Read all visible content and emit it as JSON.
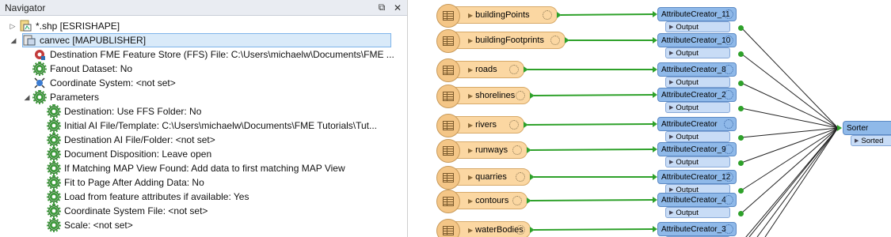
{
  "navigator": {
    "title": "Navigator",
    "tree": [
      {
        "level": 0,
        "twisty": "▷",
        "icon": "shapefile-icon",
        "label": "*.shp [ESRISHAPE]"
      },
      {
        "level": 0,
        "twisty": "◢",
        "icon": "dataset-icon",
        "label": "canvec [MAPUBLISHER]",
        "selected": true
      },
      {
        "level": 1,
        "twisty": "",
        "icon": "ffs-store-icon",
        "label": "Destination FME Feature Store (FFS) File: C:\\Users\\michaelw\\Documents\\FME ..."
      },
      {
        "level": 1,
        "twisty": "",
        "icon": "gear-icon",
        "label": "Fanout Dataset: No"
      },
      {
        "level": 1,
        "twisty": "",
        "icon": "coordinate-system-icon",
        "label": "Coordinate System: <not set>"
      },
      {
        "level": 1,
        "twisty": "◢",
        "icon": "gear-icon",
        "label": "Parameters"
      },
      {
        "level": 2,
        "twisty": "",
        "icon": "gear-icon",
        "label": "Destination: Use FFS Folder: No"
      },
      {
        "level": 2,
        "twisty": "",
        "icon": "gear-icon",
        "label": "Initial AI File/Template: C:\\Users\\michaelw\\Documents\\FME Tutorials\\Tut..."
      },
      {
        "level": 2,
        "twisty": "",
        "icon": "gear-icon",
        "label": "Destination AI File/Folder: <not set>"
      },
      {
        "level": 2,
        "twisty": "",
        "icon": "gear-icon",
        "label": "Document Disposition: Leave open"
      },
      {
        "level": 2,
        "twisty": "",
        "icon": "gear-icon",
        "label": "If Matching MAP View Found: Add data to first matching MAP View"
      },
      {
        "level": 2,
        "twisty": "",
        "icon": "gear-icon",
        "label": "Fit to Page After Adding Data: No"
      },
      {
        "level": 2,
        "twisty": "",
        "icon": "gear-icon",
        "label": "Load from feature attributes if available: Yes"
      },
      {
        "level": 2,
        "twisty": "",
        "icon": "gear-icon",
        "label": "Coordinate System File: <not set>"
      },
      {
        "level": 2,
        "twisty": "",
        "icon": "gear-icon",
        "label": "Scale: <not set>"
      }
    ]
  },
  "canvas": {
    "readers": [
      "buildingPoints",
      "buildingFootprints",
      "roads",
      "shorelines",
      "rivers",
      "runways",
      "quarries",
      "contours",
      "waterBodies"
    ],
    "transformers": [
      "AttributeCreator_11",
      "AttributeCreator_10",
      "AttributeCreator_8",
      "AttributeCreator_2",
      "AttributeCreator",
      "AttributeCreator_9",
      "AttributeCreator_12",
      "AttributeCreator_4",
      "AttributeCreator_3"
    ],
    "output_label": "Output",
    "sorter": {
      "name": "Sorter",
      "output": "Sorted"
    },
    "colors": {
      "reader_fill": "#fbd7a2",
      "transformer_fill": "#8fb9e9",
      "connector": "#2ea12a"
    }
  }
}
